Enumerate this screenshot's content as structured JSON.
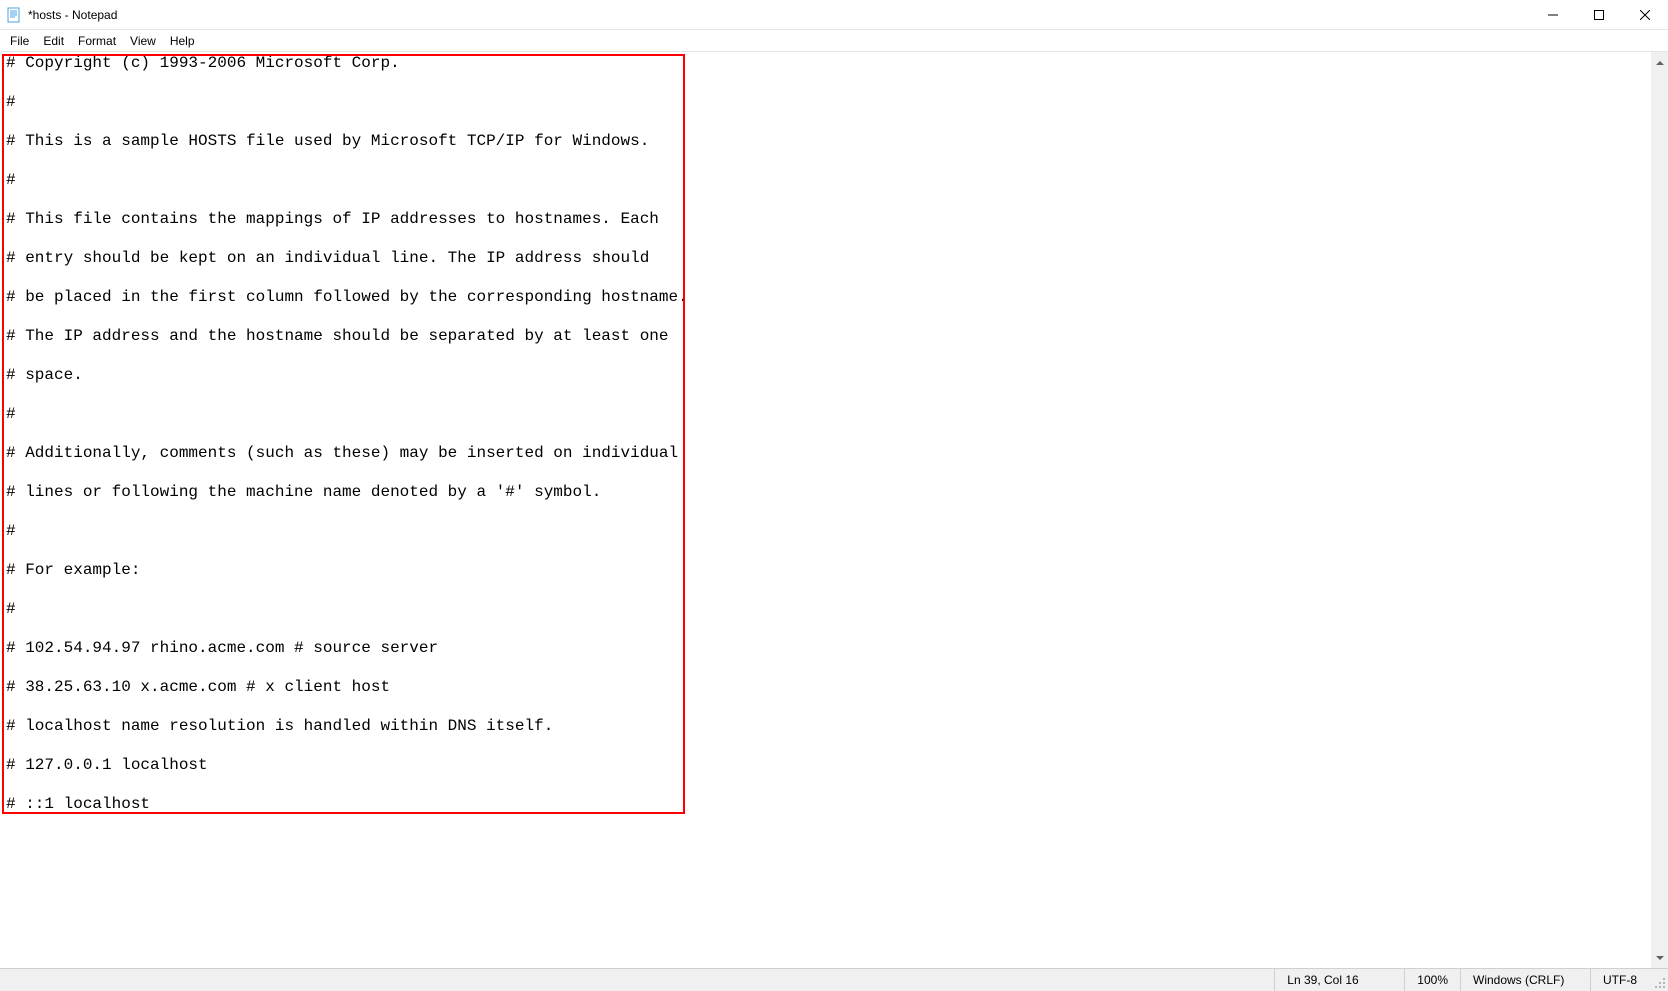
{
  "window": {
    "title": "*hosts - Notepad"
  },
  "menubar": {
    "items": [
      "File",
      "Edit",
      "Format",
      "View",
      "Help"
    ]
  },
  "editor": {
    "content": "# Copyright (c) 1993-2006 Microsoft Corp.\n\n#\n\n# This is a sample HOSTS file used by Microsoft TCP/IP for Windows.\n\n#\n\n# This file contains the mappings of IP addresses to hostnames. Each\n\n# entry should be kept on an individual line. The IP address should\n\n# be placed in the first column followed by the corresponding hostname.\n\n# The IP address and the hostname should be separated by at least one\n\n# space.\n\n#\n\n# Additionally, comments (such as these) may be inserted on individual\n\n# lines or following the machine name denoted by a '#' symbol.\n\n#\n\n# For example:\n\n#\n\n# 102.54.94.97 rhino.acme.com # source server\n\n# 38.25.63.10 x.acme.com # x client host\n\n# localhost name resolution is handled within DNS itself.\n\n# 127.0.0.1 localhost\n\n# ::1 localhost"
  },
  "statusbar": {
    "position": "Ln 39, Col 16",
    "zoom": "100%",
    "line_ending": "Windows (CRLF)",
    "encoding": "UTF-8"
  }
}
